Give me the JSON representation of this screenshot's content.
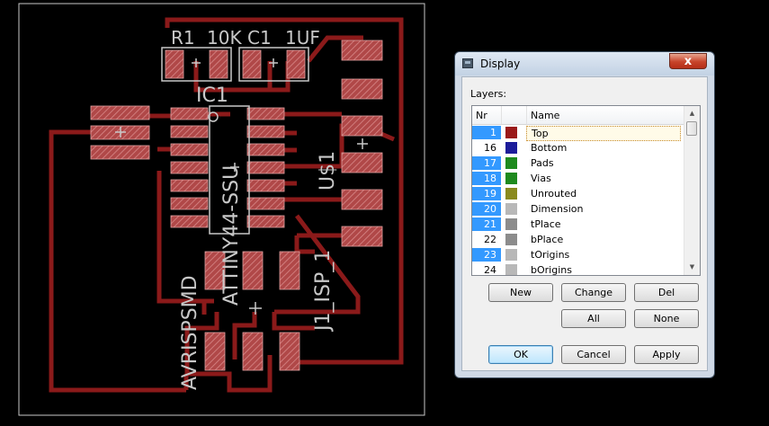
{
  "board": {
    "labels": {
      "r1": "R1",
      "r1_val": "10K",
      "c1": "C1",
      "c1_val": "1UF",
      "ic1": "IC1",
      "ic1_part": "ATTINY44-SSU",
      "usb": "U$1",
      "isp": "J1_ISP_1",
      "avr": "AVRISPSMD"
    },
    "colors": {
      "trace": "#8b1a1a",
      "pad": "#c06060",
      "silk": "#c8c8c8",
      "outline": "#c8c8c8"
    }
  },
  "dialog": {
    "title": "Display",
    "close_glyph": "x",
    "layers_label": "Layers:",
    "columns": {
      "nr": "Nr",
      "name": "Name"
    },
    "layers": [
      {
        "nr": "1",
        "name": "Top",
        "color": "#9a1a1a",
        "selected": true
      },
      {
        "nr": "16",
        "name": "Bottom",
        "color": "#1c1c9a",
        "selected": false
      },
      {
        "nr": "17",
        "name": "Pads",
        "color": "#1e8a1e",
        "selected": true
      },
      {
        "nr": "18",
        "name": "Vias",
        "color": "#1e8a1e",
        "selected": true
      },
      {
        "nr": "19",
        "name": "Unrouted",
        "color": "#8a8a1e",
        "selected": true
      },
      {
        "nr": "20",
        "name": "Dimension",
        "color": "#b8b8b8",
        "selected": true
      },
      {
        "nr": "21",
        "name": "tPlace",
        "color": "#8c8c8c",
        "selected": true
      },
      {
        "nr": "22",
        "name": "bPlace",
        "color": "#8c8c8c",
        "selected": false
      },
      {
        "nr": "23",
        "name": "tOrigins",
        "color": "#b8b8b8",
        "selected": true
      },
      {
        "nr": "24",
        "name": "bOrigins",
        "color": "#b8b8b8",
        "selected": false
      }
    ],
    "buttons": {
      "new": "New",
      "change": "Change",
      "del": "Del",
      "all": "All",
      "none": "None",
      "ok": "OK",
      "cancel": "Cancel",
      "apply": "Apply"
    }
  }
}
